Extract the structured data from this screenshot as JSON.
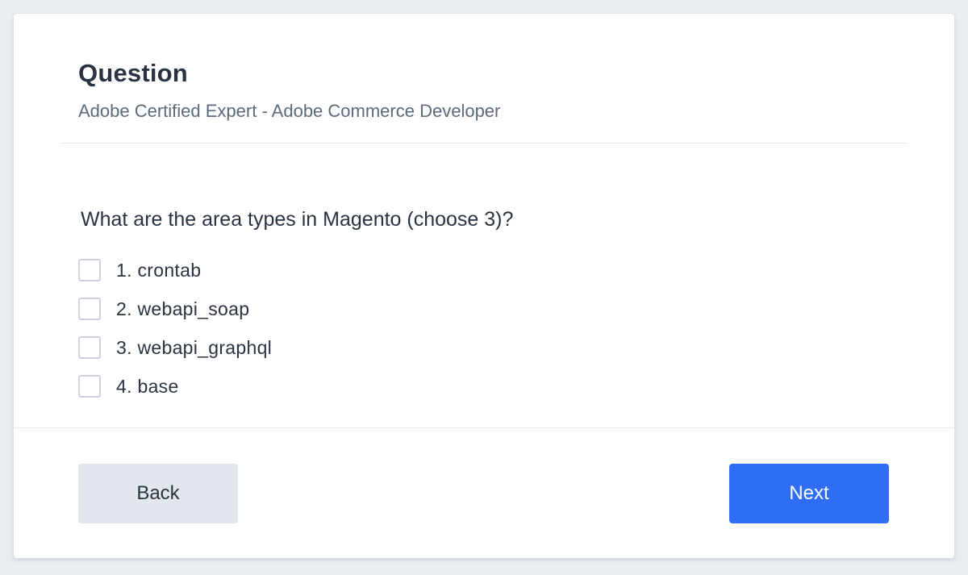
{
  "header": {
    "title": "Question",
    "subtitle": "Adobe Certified Expert - Adobe Commerce Developer"
  },
  "question": {
    "text": "What are the area types in Magento (choose 3)?",
    "options": [
      {
        "label": "1. crontab",
        "checked": false
      },
      {
        "label": "2. webapi_soap",
        "checked": false
      },
      {
        "label": "3. webapi_graphql",
        "checked": false
      },
      {
        "label": "4. base",
        "checked": false
      }
    ]
  },
  "footer": {
    "back_label": "Back",
    "next_label": "Next"
  },
  "colors": {
    "accent": "#2f6df6",
    "secondary_button": "#e2e7ee",
    "page_background": "#e9edf1"
  }
}
